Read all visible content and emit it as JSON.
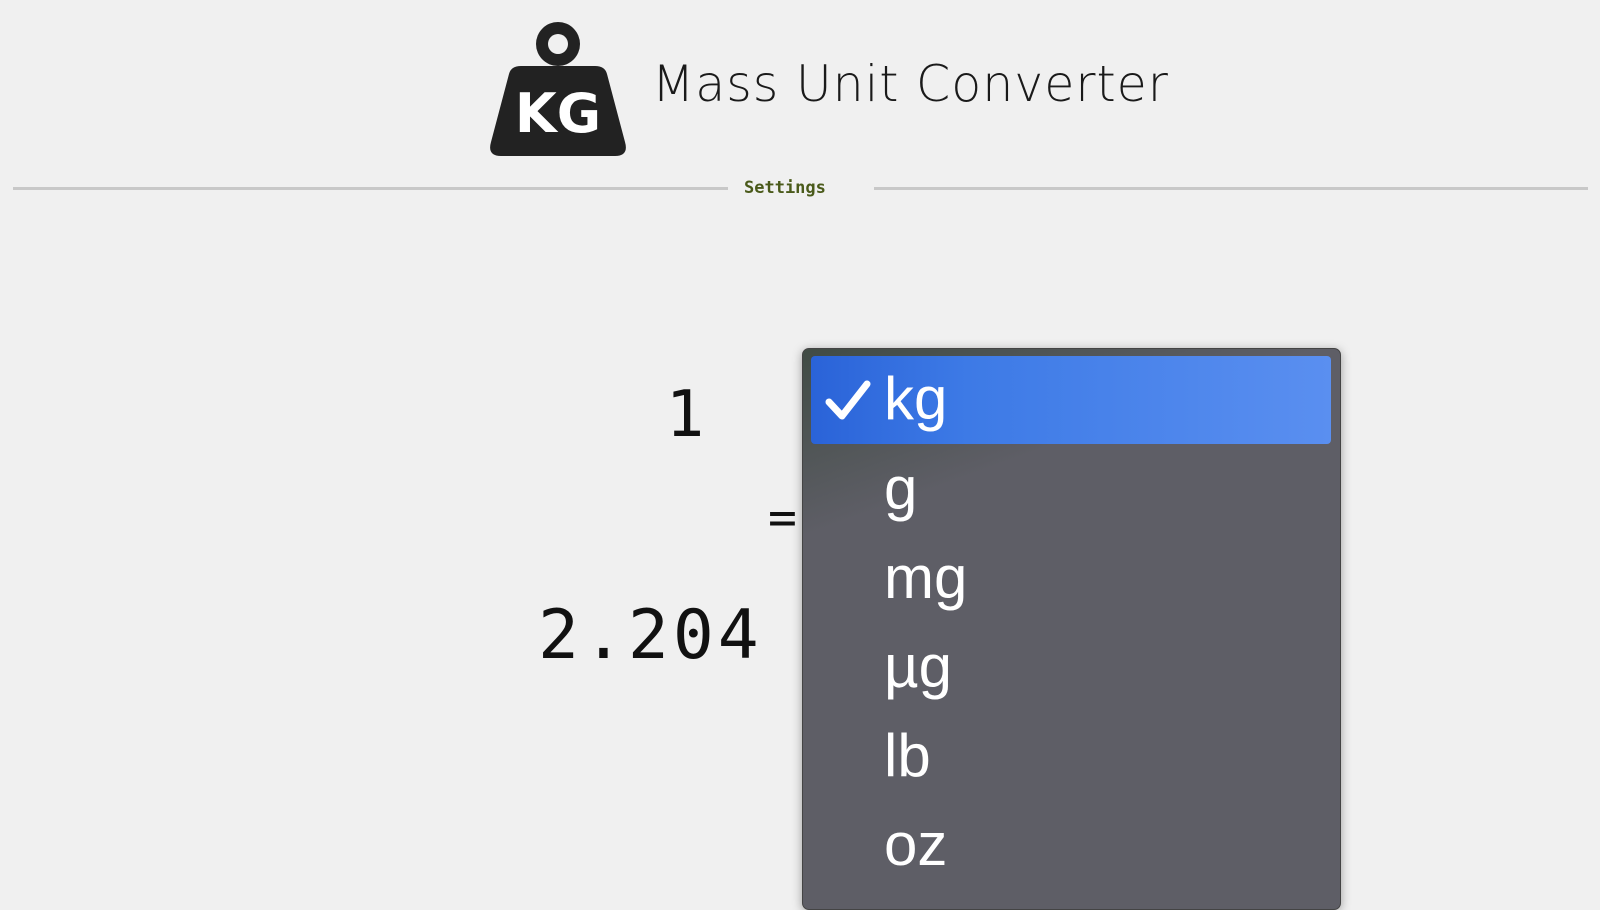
{
  "app": {
    "title": "Mass Unit Converter",
    "logo_text": "KG"
  },
  "settings": {
    "label": "Settings"
  },
  "converter": {
    "amount": "1",
    "equals": "=",
    "result_visible": "2.204"
  },
  "unit_dropdown": {
    "selected": "kg",
    "options": [
      "kg",
      "g",
      "mg",
      "µg",
      "lb",
      "oz"
    ]
  },
  "colors": {
    "background": "#f0f0f0",
    "dropdown_bg": "#5e5e66",
    "selected_highlight": "#3d7ae6",
    "settings_link": "#4a5a1a"
  }
}
